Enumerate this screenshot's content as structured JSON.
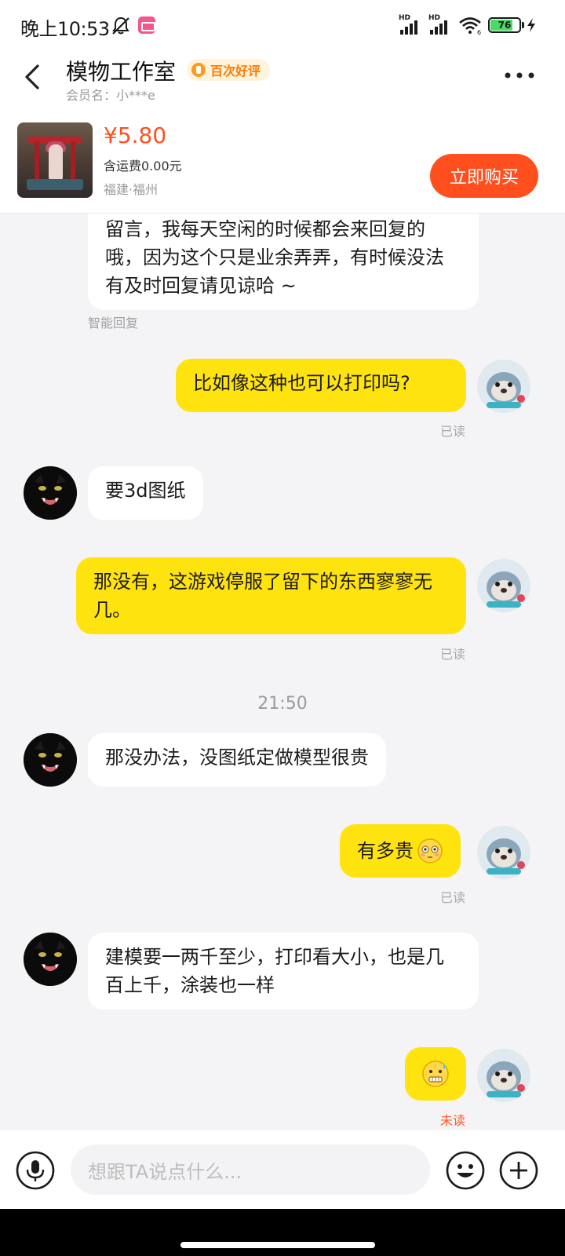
{
  "status_bar": {
    "time": "晚上10:53",
    "battery": "76",
    "battery_level_percent": 76,
    "network_1": "HD",
    "network_2": "HD",
    "wifi_badge": "6"
  },
  "header": {
    "back_icon": "back-arrow-icon",
    "shop_name": "模物工作室",
    "rating_badge": "百次好评",
    "member_line": "会员名：小***e",
    "more_icon": "more-dots-icon"
  },
  "product": {
    "price": "¥5.80",
    "shipping": "含运费0.00元",
    "location": "福建·福州",
    "buy_label": "立即购买"
  },
  "chat": {
    "messages": [
      {
        "side": "in",
        "text": "留言，我每天空闲的时候都会来回复的哦，因为这个只是业余弄弄，有时候没法有及时回复请见谅哈 ~",
        "note": "智能回复"
      },
      {
        "side": "out",
        "text": "比如像这种也可以打印吗?",
        "status": "已读"
      },
      {
        "side": "in",
        "text": "要3d图纸"
      },
      {
        "side": "out",
        "text": "那没有，这游戏停服了留下的东西寥寥无几。",
        "status": "已读"
      },
      {
        "side": "in",
        "text": "那没办法，没图纸定做模型很贵"
      },
      {
        "side": "out",
        "text": "有多贵",
        "status": "已读"
      },
      {
        "side": "in",
        "text": "建模要一两千至少，打印看大小，也是几百上千，涂装也一样"
      },
      {
        "side": "out",
        "text": "",
        "status": "未读"
      }
    ],
    "timestamp": "21:50"
  },
  "input_bar": {
    "placeholder": "想跟TA说点什么...",
    "mic_icon": "microphone-icon",
    "emoji_icon": "smiley-icon",
    "plus_icon": "plus-icon"
  },
  "colors": {
    "accent": "#ff4f1f",
    "outgoing_bubble": "#ffe30f",
    "incoming_bubble": "#ffffff",
    "background": "#f4f4f6",
    "unread": "#ff5a2a"
  }
}
